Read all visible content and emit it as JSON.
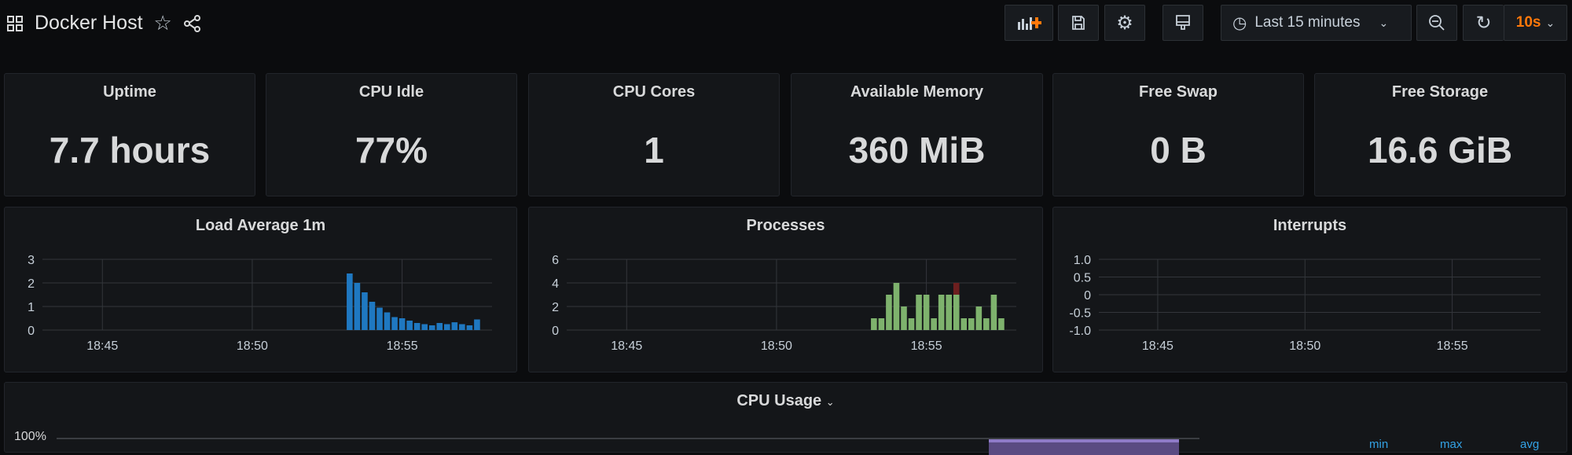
{
  "header": {
    "title": "Docker Host",
    "time_range": "Last 15 minutes",
    "refresh": "10s"
  },
  "colors": {
    "accent": "#ff780a",
    "load": "#1f78c1",
    "processes": "#7eb26d",
    "processes_alt": "#6d1f1f",
    "cpu": "#705da0",
    "legend": "#33a2e5"
  },
  "stats": [
    {
      "title": "Uptime",
      "value": "7.7 hours"
    },
    {
      "title": "CPU Idle",
      "value": "77%"
    },
    {
      "title": "CPU Cores",
      "value": "1"
    },
    {
      "title": "Available Memory",
      "value": "360 MiB"
    },
    {
      "title": "Free Swap",
      "value": "0 B"
    },
    {
      "title": "Free Storage",
      "value": "16.6 GiB"
    }
  ],
  "chart_data": [
    {
      "type": "bar",
      "title": "Load Average 1m",
      "x_ticks": [
        "18:45",
        "18:50",
        "18:55"
      ],
      "y_ticks": [
        "0",
        "1",
        "2",
        "3"
      ],
      "ylim": [
        0,
        3
      ],
      "grid": true,
      "x": [
        "18:53:15",
        "18:53:30",
        "18:53:45",
        "18:54:00",
        "18:54:15",
        "18:54:30",
        "18:54:45",
        "18:55:00",
        "18:55:15",
        "18:55:30",
        "18:55:45",
        "18:56:00",
        "18:56:15",
        "18:56:30",
        "18:56:45",
        "18:57:00",
        "18:57:15",
        "18:57:30"
      ],
      "series": [
        {
          "values": [
            2.4,
            2.0,
            1.6,
            1.2,
            0.95,
            0.75,
            0.55,
            0.5,
            0.4,
            0.3,
            0.25,
            0.2,
            0.3,
            0.25,
            0.33,
            0.25,
            0.2,
            0.45
          ]
        }
      ]
    },
    {
      "type": "bar",
      "title": "Processes",
      "x_ticks": [
        "18:45",
        "18:50",
        "18:55"
      ],
      "y_ticks": [
        "0",
        "2",
        "4",
        "6"
      ],
      "ylim": [
        0,
        6
      ],
      "grid": true,
      "stacked": true,
      "x": [
        "18:53:15",
        "18:53:30",
        "18:53:45",
        "18:54:00",
        "18:54:15",
        "18:54:30",
        "18:54:45",
        "18:55:00",
        "18:55:15",
        "18:55:30",
        "18:55:45",
        "18:56:00",
        "18:56:15",
        "18:56:30",
        "18:56:45",
        "18:57:00",
        "18:57:15",
        "18:57:30"
      ],
      "series": [
        {
          "values": [
            1,
            1,
            3,
            4,
            2,
            1,
            3,
            3,
            1,
            3,
            3,
            3,
            1,
            1,
            2,
            1,
            3,
            1
          ]
        },
        {
          "values": [
            0,
            0,
            0,
            0,
            0,
            0,
            0,
            0,
            0,
            0,
            0,
            1,
            0,
            0,
            0,
            0,
            0,
            0
          ]
        }
      ]
    },
    {
      "type": "bar",
      "title": "Interrupts",
      "x_ticks": [
        "18:45",
        "18:50",
        "18:55"
      ],
      "y_ticks": [
        "-1.0",
        "-0.5",
        "0",
        "0.5",
        "1.0"
      ],
      "ylim": [
        -1,
        1
      ],
      "grid": true,
      "x": [],
      "series": []
    }
  ],
  "cpu_panel": {
    "title": "CPU Usage",
    "y_top": "100%",
    "legend": [
      "min",
      "max",
      "avg"
    ]
  }
}
